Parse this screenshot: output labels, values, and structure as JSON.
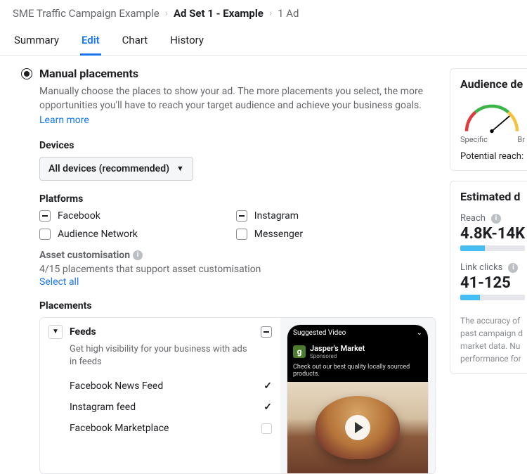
{
  "breadcrumb": {
    "campaign": "SME Traffic Campaign Example",
    "adset": "Ad Set 1 - Example",
    "ads": "1 Ad"
  },
  "tabs": {
    "summary": "Summary",
    "edit": "Edit",
    "chart": "Chart",
    "history": "History"
  },
  "manual": {
    "title": "Manual placements",
    "desc": "Manually choose the places to show your ad. The more placements you select, the more opportunities you'll have to reach your target audience and achieve your business goals.",
    "learn_more": "Learn more"
  },
  "devices": {
    "label": "Devices",
    "value": "All devices (recommended)"
  },
  "platforms": {
    "label": "Platforms",
    "facebook": "Facebook",
    "instagram": "Instagram",
    "audience_network": "Audience Network",
    "messenger": "Messenger"
  },
  "asset": {
    "label": "Asset customisation",
    "support": "4/15 placements that support asset customisation",
    "select_all": "Select all"
  },
  "placements": {
    "label": "Placements",
    "feeds_title": "Feeds",
    "feeds_desc": "Get high visibility for your business with ads in feeds",
    "items": {
      "fb_news": "Facebook News Feed",
      "ig_feed": "Instagram feed",
      "fb_marketplace": "Facebook Marketplace"
    }
  },
  "preview": {
    "suggested": "Suggested Video",
    "brand": "Jasper's Market",
    "sponsored": "Sponsored",
    "tagline": "Check out our best quality locally sourced products."
  },
  "audience": {
    "title": "Audience de",
    "specific": "Specific",
    "broad": "Br",
    "potential": "Potential reach: "
  },
  "estimated": {
    "title": "Estimated d",
    "reach_label": "Reach",
    "reach_value": "4.8K-14K",
    "clicks_label": "Link clicks",
    "clicks_value": "41-125",
    "disclaimer1": "The accuracy of",
    "disclaimer2": "past campaign d",
    "disclaimer3": "market data. Nu",
    "disclaimer4": "performance for"
  }
}
